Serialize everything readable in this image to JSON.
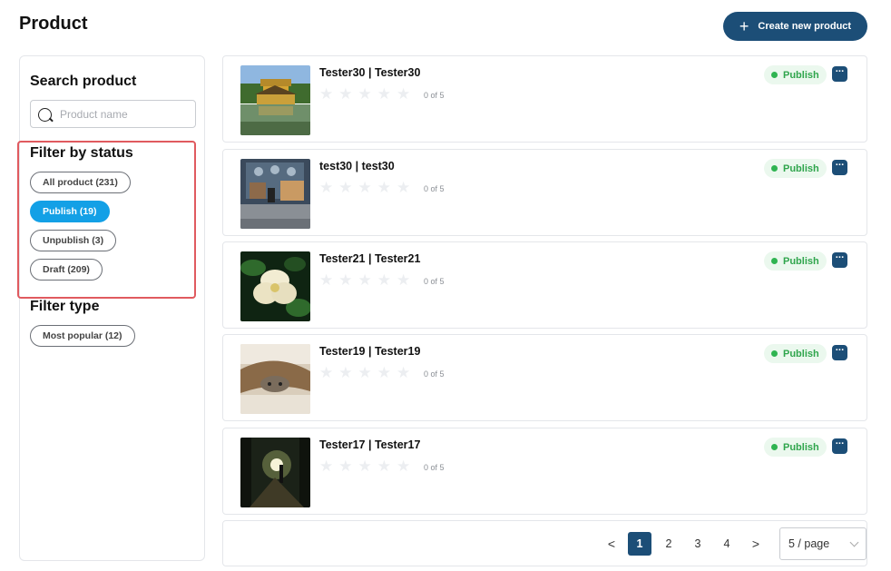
{
  "header": {
    "title": "Product",
    "create_button_label": "Create new product"
  },
  "sidebar": {
    "search_heading": "Search product",
    "search_placeholder": "Product name",
    "status_heading": "Filter by status",
    "status_filters": [
      {
        "label": "All product (231)",
        "active": false
      },
      {
        "label": "Publish (19)",
        "active": true
      },
      {
        "label": "Unpublish (3)",
        "active": false
      },
      {
        "label": "Draft (209)",
        "active": false
      }
    ],
    "type_heading": "Filter type",
    "type_filters": [
      {
        "label": "Most popular (12)",
        "active": false
      }
    ]
  },
  "products": [
    {
      "title": "Tester30 | Tester30",
      "rating_text": "0 of 5",
      "rating": 0,
      "status": "Publish",
      "image": "golden-pavilion"
    },
    {
      "title": "test30 | test30",
      "rating_text": "0 of 5",
      "rating": 0,
      "status": "Publish",
      "image": "anime-storefront"
    },
    {
      "title": "Tester21 | Tester21",
      "rating_text": "0 of 5",
      "rating": 0,
      "status": "Publish",
      "image": "white-flower"
    },
    {
      "title": "Tester19 | Tester19",
      "rating_text": "0 of 5",
      "rating": 0,
      "status": "Publish",
      "image": "cat-under-blanket"
    },
    {
      "title": "Tester17 | Tester17",
      "rating_text": "0 of 5",
      "rating": 0,
      "status": "Publish",
      "image": "backlit-street"
    }
  ],
  "pagination": {
    "prev_label": "<",
    "next_label": ">",
    "pages": [
      "1",
      "2",
      "3",
      "4"
    ],
    "current_page": "1",
    "page_size_label": "5 / page"
  },
  "colors": {
    "primary": "#1c4e77",
    "active_filter": "#13a0e6",
    "publish_text": "#2fa54c",
    "publish_bg": "#ebf8ee",
    "highlight_border": "#e05a5f"
  }
}
